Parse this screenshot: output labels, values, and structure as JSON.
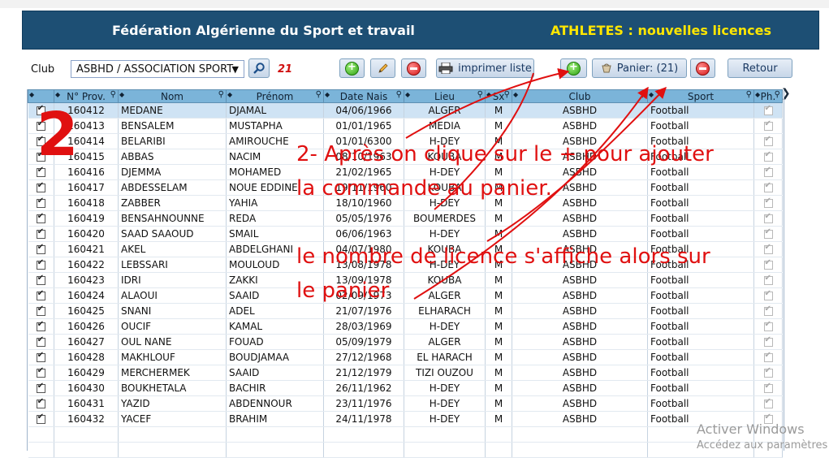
{
  "header": {
    "title": "Fédération Algérienne du Sport et travail",
    "subtitle": "ATHLETES : nouvelles licences"
  },
  "toolbar": {
    "club_label": "Club",
    "club_value": "ASBHD / ASSOCIATION SPORT",
    "count": "21",
    "print_label": "imprimer liste",
    "cart_label": "Panier: (21)",
    "back_label": "Retour"
  },
  "columns": [
    "N° Prov.",
    "Nom",
    "Prénom",
    "Date Nais",
    "Lieu",
    "Sx",
    "Club",
    "Sport",
    "Ph."
  ],
  "rows": [
    {
      "id": "160412",
      "nom": "MEDANE",
      "prenom": "DJAMAL",
      "date": "04/06/1966",
      "lieu": "ALGER",
      "sx": "M",
      "club": "ASBHD",
      "sport": "Football"
    },
    {
      "id": "160413",
      "nom": "BENSALEM",
      "prenom": "MUSTAPHA",
      "date": "01/01/1965",
      "lieu": "MEDIA",
      "sx": "M",
      "club": "ASBHD",
      "sport": "Football"
    },
    {
      "id": "160414",
      "nom": "BELARIBI",
      "prenom": "AMIROUCHE",
      "date": "01/01/6300",
      "lieu": "H-DEY",
      "sx": "M",
      "club": "ASBHD",
      "sport": "Football"
    },
    {
      "id": "160415",
      "nom": "ABBAS",
      "prenom": "NACIM",
      "date": "08/10/1963",
      "lieu": "KOUBA",
      "sx": "M",
      "club": "ASBHD",
      "sport": "Football"
    },
    {
      "id": "160416",
      "nom": "DJEMMA",
      "prenom": "MOHAMED",
      "date": "21/02/1965",
      "lieu": "H-DEY",
      "sx": "M",
      "club": "ASBHD",
      "sport": "Football"
    },
    {
      "id": "160417",
      "nom": "ABDESSELAM",
      "prenom": "NOUE EDDINE",
      "date": "19/11/1960",
      "lieu": "KOUBA",
      "sx": "M",
      "club": "ASBHD",
      "sport": "Football"
    },
    {
      "id": "160418",
      "nom": "ZABBER",
      "prenom": "YAHIA",
      "date": "18/10/1960",
      "lieu": "H-DEY",
      "sx": "M",
      "club": "ASBHD",
      "sport": "Football"
    },
    {
      "id": "160419",
      "nom": "BENSAHNOUNNE",
      "prenom": "REDA",
      "date": "05/05/1976",
      "lieu": "BOUMERDES",
      "sx": "M",
      "club": "ASBHD",
      "sport": "Football"
    },
    {
      "id": "160420",
      "nom": "SAAD SAAOUD",
      "prenom": "SMAIL",
      "date": "06/06/1963",
      "lieu": "H-DEY",
      "sx": "M",
      "club": "ASBHD",
      "sport": "Football"
    },
    {
      "id": "160421",
      "nom": "AKEL",
      "prenom": "ABDELGHANI",
      "date": "04/07/1980",
      "lieu": "KOUBA",
      "sx": "M",
      "club": "ASBHD",
      "sport": "Football"
    },
    {
      "id": "160422",
      "nom": "LEBSSARI",
      "prenom": "MOULOUD",
      "date": "13/08/1978",
      "lieu": "H-DEY",
      "sx": "M",
      "club": "ASBHD",
      "sport": "Football"
    },
    {
      "id": "160423",
      "nom": "IDRI",
      "prenom": "ZAKKI",
      "date": "13/09/1978",
      "lieu": "KOUBA",
      "sx": "M",
      "club": "ASBHD",
      "sport": "Football"
    },
    {
      "id": "160424",
      "nom": "ALAOUI",
      "prenom": "SAAID",
      "date": "02/09/1973",
      "lieu": "ALGER",
      "sx": "M",
      "club": "ASBHD",
      "sport": "Football"
    },
    {
      "id": "160425",
      "nom": "SNANI",
      "prenom": "ADEL",
      "date": "21/07/1976",
      "lieu": "ELHARACH",
      "sx": "M",
      "club": "ASBHD",
      "sport": "Football"
    },
    {
      "id": "160426",
      "nom": "OUCIF",
      "prenom": "KAMAL",
      "date": "28/03/1969",
      "lieu": "H-DEY",
      "sx": "M",
      "club": "ASBHD",
      "sport": "Football"
    },
    {
      "id": "160427",
      "nom": "OUL NANE",
      "prenom": "FOUAD",
      "date": "05/09/1979",
      "lieu": "ALGER",
      "sx": "M",
      "club": "ASBHD",
      "sport": "Football"
    },
    {
      "id": "160428",
      "nom": "MAKHLOUF",
      "prenom": "BOUDJAMAA",
      "date": "27/12/1968",
      "lieu": "EL HARACH",
      "sx": "M",
      "club": "ASBHD",
      "sport": "Football"
    },
    {
      "id": "160429",
      "nom": "MERCHERMEK",
      "prenom": "SAAID",
      "date": "21/12/1979",
      "lieu": "TIZI OUZOU",
      "sx": "M",
      "club": "ASBHD",
      "sport": "Football"
    },
    {
      "id": "160430",
      "nom": "BOUKHETALA",
      "prenom": "BACHIR",
      "date": "26/11/1962",
      "lieu": "H-DEY",
      "sx": "M",
      "club": "ASBHD",
      "sport": "Football"
    },
    {
      "id": "160431",
      "nom": "YAZID",
      "prenom": "ABDENNOUR",
      "date": "23/11/1976",
      "lieu": "H-DEY",
      "sx": "M",
      "club": "ASBHD",
      "sport": "Football"
    },
    {
      "id": "160432",
      "nom": "YACEF",
      "prenom": "BRAHIM",
      "date": "24/11/1978",
      "lieu": "H-DEY",
      "sx": "M",
      "club": "ASBHD",
      "sport": "Football"
    }
  ],
  "annotation": {
    "number": "2",
    "line1": "2- Après on clique sur le + pour ajouter",
    "line2": "la commande au panier.",
    "line3": "le nombre de licence s'affiche alors sur",
    "line4": "le panier"
  },
  "watermark": {
    "title": "Activer Windows",
    "subtitle": "Accédez aux paramètres"
  },
  "colors": {
    "header_bg": "#1d4f74",
    "header_accent": "#ffe600",
    "grid_header": "#7bb4d9",
    "annotation": "#e01010"
  }
}
